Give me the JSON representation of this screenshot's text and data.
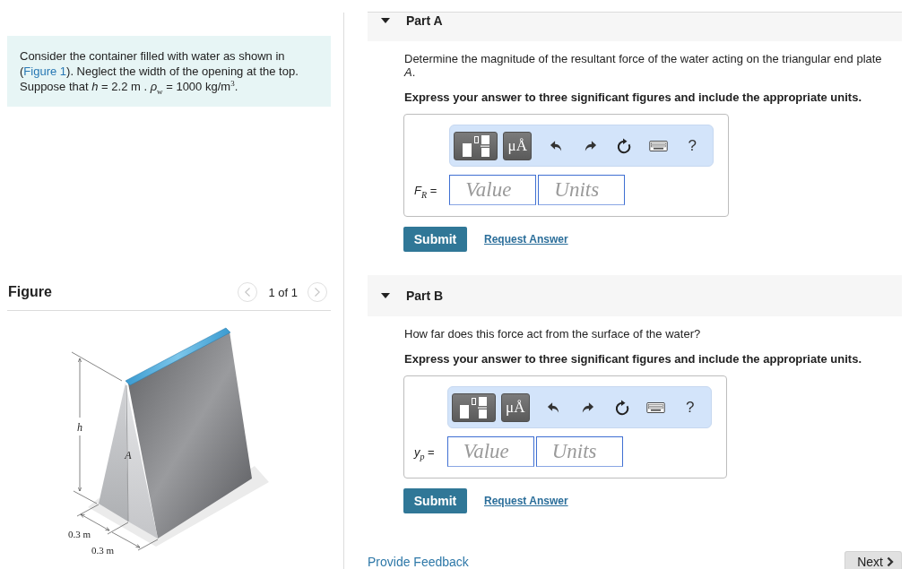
{
  "problem": {
    "text_before": "Consider the container filled with water as shown in (",
    "link": "Figure 1",
    "text_after": "). Neglect the width of the opening at the top. Suppose that *h* = 2.2  m . *ρ*$_{w}$ = 1000 kg/m$^{3}$."
  },
  "figure": {
    "title": "Figure",
    "pager": "1 of 1",
    "prev": {
      "disabled": true
    },
    "next": {
      "disabled": true
    },
    "labels": {
      "height": "h",
      "plate": "A",
      "width_left": "0.3 m",
      "width_right": "0.3 m"
    }
  },
  "parts": [
    {
      "title": "Part A",
      "expanded": true,
      "question": "Determine the magnitude of the resultant force of the water acting on the triangular end plate *A*.",
      "instruction": "Express your answer to three significant figures and include the appropriate units.",
      "toolbar": {
        "units_button": "μÅ",
        "help_button": "?"
      },
      "answer_label": "*F*$_{R}$ =",
      "value_placeholder": "Value",
      "units_placeholder": "Units",
      "submit": "Submit",
      "request_answer": "Request Answer"
    },
    {
      "title": "Part B",
      "expanded": true,
      "question": "How far does this force act from the surface of the water?",
      "instruction": "Express your answer to three significant figures and include the appropriate units.",
      "toolbar": {
        "units_button": "μÅ",
        "help_button": "?"
      },
      "answer_label": "*y*$_{p}$ =",
      "value_placeholder": "Value",
      "units_placeholder": "Units",
      "submit": "Submit",
      "request_answer": "Request Answer"
    }
  ],
  "footer": {
    "feedback_link": "Provide Feedback",
    "next_button": "Next"
  }
}
